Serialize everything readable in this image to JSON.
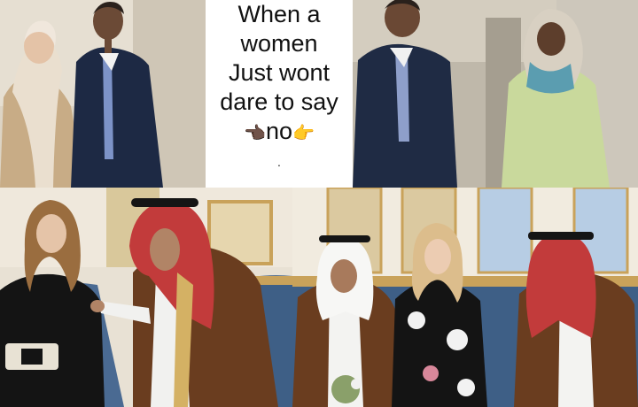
{
  "caption": {
    "line1": "When a",
    "line2": "women",
    "line3": "Just wont",
    "line4": "dare to say",
    "word": "no",
    "left_emoji": "👈🏿",
    "right_emoji": "👉",
    "dot": "."
  },
  "colors": {
    "caption_bg": "#ffffff",
    "caption_text": "#111111",
    "palace_wall": "#e9e2d6",
    "ornate_gold": "#c9a25a",
    "couch_blue": "#3e5f86",
    "suit_navy": "#1e2b45",
    "bisht_brown": "#6a3d1f",
    "keffiyeh_red": "#c23b3b",
    "mosque_tile": "#c9c3b6"
  },
  "panels": {
    "top_left": "photo",
    "top_right": "photo",
    "bottom_left": "photo",
    "bottom_right": "photo"
  }
}
